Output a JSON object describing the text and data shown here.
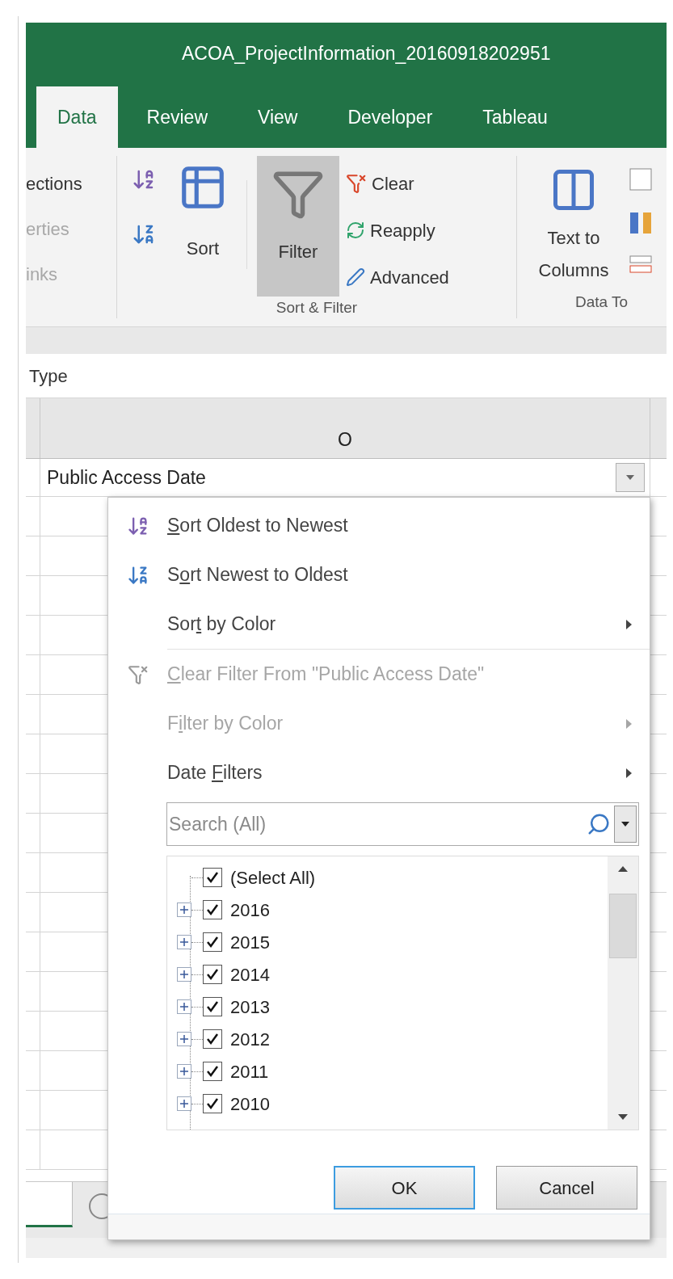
{
  "window": {
    "title": "ACOA_ProjectInformation_20160918202951"
  },
  "tabs": [
    {
      "label": "Data",
      "selected": true
    },
    {
      "label": "Review",
      "selected": false
    },
    {
      "label": "View",
      "selected": false
    },
    {
      "label": "Developer",
      "selected": false
    },
    {
      "label": "Tableau",
      "selected": false
    }
  ],
  "ribbon": {
    "connections": [
      {
        "label": "ections",
        "disabled": false
      },
      {
        "label": "erties",
        "disabled": true
      },
      {
        "label": "inks",
        "disabled": true
      }
    ],
    "sort_filter": {
      "label": "Sort & Filter",
      "sort": "Sort",
      "filter": {
        "label": "Filter",
        "selected": true
      },
      "commands": [
        {
          "kind": "clear",
          "label": "Clear"
        },
        {
          "kind": "reapply",
          "label": "Reapply"
        },
        {
          "kind": "advanced",
          "label": "Advanced"
        }
      ]
    },
    "data_tools": {
      "label": "Data To",
      "button": "Text to Columns"
    }
  },
  "formula_bar": {
    "value": "Type"
  },
  "sheet": {
    "column_header": "O",
    "header_cell": "Public Access Date"
  },
  "filter_menu": {
    "items": [
      {
        "kind": "sort_asc",
        "mnemonic": "S",
        "after": "ort Oldest to Newest",
        "disabled": false,
        "submenu": false
      },
      {
        "kind": "sort_desc",
        "before": "S",
        "mnemonic": "o",
        "after": "rt Newest to Oldest",
        "disabled": false,
        "submenu": false
      },
      {
        "kind": "plain",
        "before": "Sor",
        "mnemonic": "t",
        "after": " by Color",
        "disabled": false,
        "submenu": true
      },
      {
        "kind": "clear_filter",
        "mnemonic": "C",
        "after": "lear Filter From \"Public Access Date\"",
        "disabled": true,
        "submenu": false
      },
      {
        "kind": "plain",
        "before": "F",
        "mnemonic": "i",
        "after": "lter by Color",
        "disabled": true,
        "submenu": true
      },
      {
        "kind": "plain",
        "before": "Date ",
        "mnemonic": "F",
        "after": "ilters",
        "disabled": false,
        "submenu": true
      }
    ],
    "search": {
      "placeholder": "Search (All)"
    },
    "tree": [
      {
        "label": "(Select All)",
        "checked": true,
        "expandable": false
      },
      {
        "label": "2016",
        "checked": true,
        "expandable": true
      },
      {
        "label": "2015",
        "checked": true,
        "expandable": true
      },
      {
        "label": "2014",
        "checked": true,
        "expandable": true
      },
      {
        "label": "2013",
        "checked": true,
        "expandable": true
      },
      {
        "label": "2012",
        "checked": true,
        "expandable": true
      },
      {
        "label": "2011",
        "checked": true,
        "expandable": true
      },
      {
        "label": "2010",
        "checked": true,
        "expandable": true
      }
    ],
    "buttons": [
      {
        "label": "OK",
        "default": true
      },
      {
        "label": "Cancel",
        "default": false
      }
    ]
  }
}
